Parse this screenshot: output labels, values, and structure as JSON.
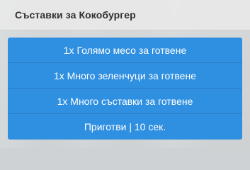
{
  "dialog": {
    "title": "Съставки за Кокобургер"
  },
  "actions": [
    {
      "label": "1x Голямо месо за готвене"
    },
    {
      "label": "1x Много зеленчуци за готвене"
    },
    {
      "label": "1x Много съставки за готвене"
    },
    {
      "label": "Приготви | 10 сек."
    }
  ],
  "colors": {
    "button_background": "#2f8fe0",
    "header_background": "#e8e8e8",
    "title_text": "#303030"
  }
}
